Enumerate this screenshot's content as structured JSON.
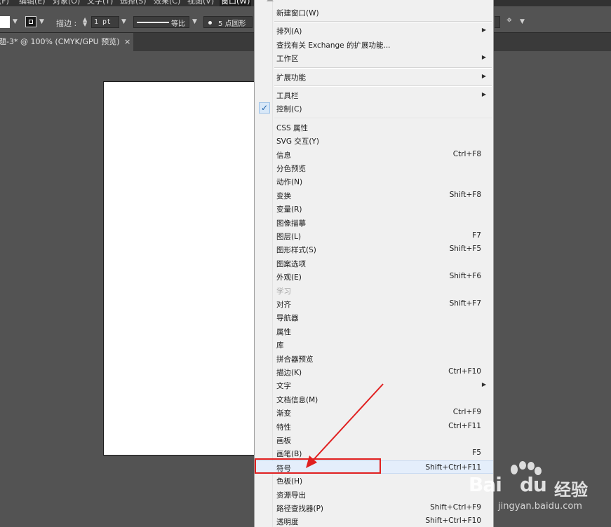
{
  "menubar": {
    "items": [
      {
        "label": "(F)"
      },
      {
        "label": "编辑(E)"
      },
      {
        "label": "对象(O)"
      },
      {
        "label": "文字(T)"
      },
      {
        "label": "选择(S)"
      },
      {
        "label": "效果(C)"
      },
      {
        "label": "视图(V)"
      },
      {
        "label": "窗口(W)"
      }
    ]
  },
  "controlbar": {
    "stroke_label": "描边 :",
    "stroke_value": "1 pt",
    "profile_label": "等比",
    "brush_label": "5 点圆形"
  },
  "document_tab": {
    "title": "题-3* @ 100% (CMYK/GPU 预览)",
    "close": "×"
  },
  "window_menu": {
    "items": [
      {
        "label": "新建窗口(W)",
        "shortcut": "",
        "submenu": false,
        "checked": false,
        "disabled": false
      },
      {
        "label": "排列(A)",
        "shortcut": "",
        "submenu": true,
        "checked": false,
        "disabled": false
      },
      {
        "label": "查找有关 Exchange 的扩展功能...",
        "shortcut": "",
        "submenu": false,
        "checked": false,
        "disabled": false
      },
      {
        "label": "工作区",
        "shortcut": "",
        "submenu": true,
        "checked": false,
        "disabled": false
      },
      {
        "label": "扩展功能",
        "shortcut": "",
        "submenu": true,
        "checked": false,
        "disabled": false
      },
      {
        "label": "工具栏",
        "shortcut": "",
        "submenu": true,
        "checked": false,
        "disabled": false
      },
      {
        "label": "控制(C)",
        "shortcut": "",
        "submenu": false,
        "checked": true,
        "disabled": false
      },
      {
        "label": "CSS 属性",
        "shortcut": "",
        "submenu": false,
        "checked": false,
        "disabled": false
      },
      {
        "label": "SVG 交互(Y)",
        "shortcut": "",
        "submenu": false,
        "checked": false,
        "disabled": false
      },
      {
        "label": "信息",
        "shortcut": "Ctrl+F8",
        "submenu": false,
        "checked": false,
        "disabled": false
      },
      {
        "label": "分色预览",
        "shortcut": "",
        "submenu": false,
        "checked": false,
        "disabled": false
      },
      {
        "label": "动作(N)",
        "shortcut": "",
        "submenu": false,
        "checked": false,
        "disabled": false
      },
      {
        "label": "变换",
        "shortcut": "Shift+F8",
        "submenu": false,
        "checked": false,
        "disabled": false
      },
      {
        "label": "变量(R)",
        "shortcut": "",
        "submenu": false,
        "checked": false,
        "disabled": false
      },
      {
        "label": "图像描摹",
        "shortcut": "",
        "submenu": false,
        "checked": false,
        "disabled": false
      },
      {
        "label": "图层(L)",
        "shortcut": "F7",
        "submenu": false,
        "checked": false,
        "disabled": false
      },
      {
        "label": "图形样式(S)",
        "shortcut": "Shift+F5",
        "submenu": false,
        "checked": false,
        "disabled": false
      },
      {
        "label": "图案选项",
        "shortcut": "",
        "submenu": false,
        "checked": false,
        "disabled": false
      },
      {
        "label": "外观(E)",
        "shortcut": "Shift+F6",
        "submenu": false,
        "checked": false,
        "disabled": false
      },
      {
        "label": "学习",
        "shortcut": "",
        "submenu": false,
        "checked": false,
        "disabled": true
      },
      {
        "label": "对齐",
        "shortcut": "Shift+F7",
        "submenu": false,
        "checked": false,
        "disabled": false
      },
      {
        "label": "导航器",
        "shortcut": "",
        "submenu": false,
        "checked": false,
        "disabled": false
      },
      {
        "label": "属性",
        "shortcut": "",
        "submenu": false,
        "checked": false,
        "disabled": false
      },
      {
        "label": "库",
        "shortcut": "",
        "submenu": false,
        "checked": false,
        "disabled": false
      },
      {
        "label": "拼合器预览",
        "shortcut": "",
        "submenu": false,
        "checked": false,
        "disabled": false
      },
      {
        "label": "描边(K)",
        "shortcut": "Ctrl+F10",
        "submenu": false,
        "checked": false,
        "disabled": false
      },
      {
        "label": "文字",
        "shortcut": "",
        "submenu": true,
        "checked": false,
        "disabled": false
      },
      {
        "label": "文档信息(M)",
        "shortcut": "",
        "submenu": false,
        "checked": false,
        "disabled": false
      },
      {
        "label": "渐变",
        "shortcut": "Ctrl+F9",
        "submenu": false,
        "checked": false,
        "disabled": false
      },
      {
        "label": "特性",
        "shortcut": "Ctrl+F11",
        "submenu": false,
        "checked": false,
        "disabled": false
      },
      {
        "label": "画板",
        "shortcut": "",
        "submenu": false,
        "checked": false,
        "disabled": false
      },
      {
        "label": "画笔(B)",
        "shortcut": "F5",
        "submenu": false,
        "checked": false,
        "disabled": false
      },
      {
        "label": "符号",
        "shortcut": "Shift+Ctrl+F11",
        "submenu": false,
        "checked": false,
        "disabled": false,
        "highlighted": true
      },
      {
        "label": "色板(H)",
        "shortcut": "",
        "submenu": false,
        "checked": false,
        "disabled": false
      },
      {
        "label": "资源导出",
        "shortcut": "",
        "submenu": false,
        "checked": false,
        "disabled": false
      },
      {
        "label": "路径查找器(P)",
        "shortcut": "Shift+Ctrl+F9",
        "submenu": false,
        "checked": false,
        "disabled": false
      },
      {
        "label": "透明度",
        "shortcut": "Shift+Ctrl+F10",
        "submenu": false,
        "checked": false,
        "disabled": false
      }
    ]
  },
  "annotation": {
    "color": "#e02020"
  },
  "watermark": {
    "brand": "Bai",
    "brand2": "du",
    "cn": "经验",
    "url": "jingyan.baidu.com"
  },
  "colors": {
    "workspace": "#535353",
    "menu_bg": "#f0f0f0",
    "highlight": "#e4eefb",
    "annotation": "#e02020"
  }
}
